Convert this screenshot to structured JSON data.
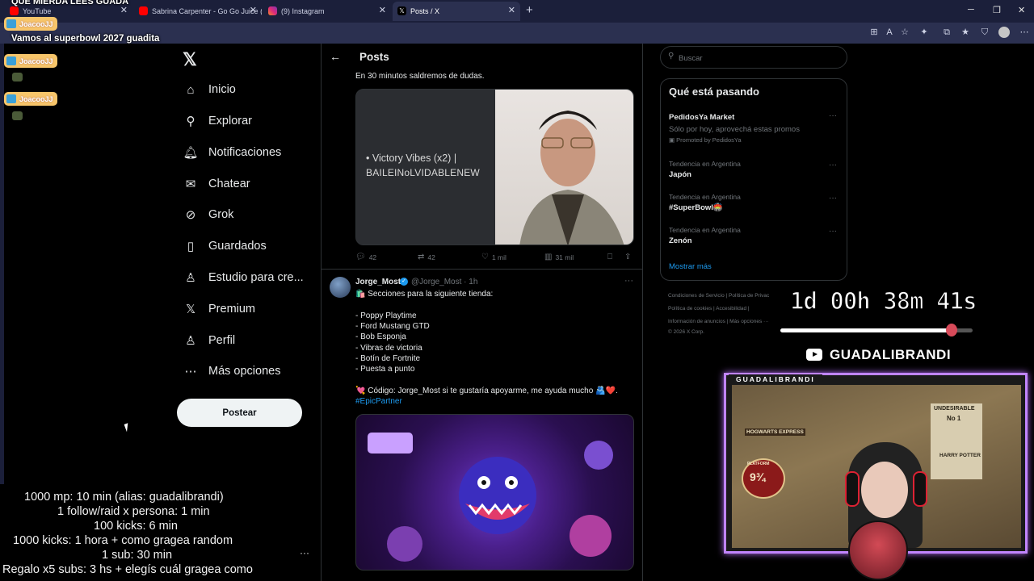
{
  "browser": {
    "tabs": [
      {
        "label": "YouTube",
        "active": false
      },
      {
        "label": "Sabrina Carpenter - Go Go Juice (O",
        "active": false
      },
      {
        "label": "(9) Instagram",
        "active": false
      },
      {
        "label": "Posts / X",
        "active": true
      }
    ],
    "new_tab": "+",
    "window_controls": [
      "─",
      "❐",
      "✕"
    ]
  },
  "sidebar": {
    "logo": "𝕏",
    "items": [
      {
        "label": "Inicio",
        "icon": "home-icon",
        "glyph": "⌂"
      },
      {
        "label": "Explorar",
        "icon": "search-icon",
        "glyph": "⚲"
      },
      {
        "label": "Notificaciones",
        "icon": "bell-icon",
        "glyph": "🔔︎"
      },
      {
        "label": "Chatear",
        "icon": "mail-icon",
        "glyph": "✉"
      },
      {
        "label": "Grok",
        "icon": "grok-icon",
        "glyph": "⊘"
      },
      {
        "label": "Guardados",
        "icon": "bookmark-icon",
        "glyph": "▯"
      },
      {
        "label": "Estudio para cre...",
        "icon": "flask-icon",
        "glyph": "♙"
      },
      {
        "label": "Premium",
        "icon": "x-premium-icon",
        "glyph": "𝕏"
      },
      {
        "label": "Perfil",
        "icon": "person-icon",
        "glyph": "♙"
      },
      {
        "label": "Más opciones",
        "icon": "more-circle-icon",
        "glyph": "⋯"
      }
    ],
    "post_button": "Postear"
  },
  "main": {
    "header_title": "Posts",
    "tweet1": {
      "text": "En 30 minutos saldremos de dudas.",
      "media_line1": "• Victory Vibes (x2) |",
      "media_line2": "BAILEINoLVIDABLENEW",
      "replies": "42",
      "reposts": "42",
      "likes": "1 mil",
      "views": "31 mil"
    },
    "tweet2": {
      "name": "Jorge_Most",
      "handle": "@Jorge_Most · 1h",
      "lines": [
        "🛍️ Secciones para la siguiente tienda:",
        "",
        "- Poppy Playtime",
        "- Ford Mustang GTD",
        "- Bob Esponja",
        "- Vibras de victoria",
        "- Botín de Fortnite",
        "- Puesta a punto",
        "",
        "💘 Código: Jorge_Most si te gustaría apoyarme, me ayuda mucho 🫂❤️."
      ],
      "hashtag": "#EpicPartner"
    }
  },
  "right": {
    "search_placeholder": "Buscar",
    "trends_title": "Qué está pasando",
    "trends": [
      {
        "top": "PedidosYa Market",
        "middle": "Sólo por hoy, aprovechá estas promos",
        "bottom": "Promoted by PedidosYa"
      },
      {
        "top": "Tendencia en Argentina",
        "middle": "Japón"
      },
      {
        "top": "Tendencia en Argentina",
        "middle": "#SuperBowl🏟️"
      },
      {
        "top": "Tendencia en Argentina",
        "middle": "Zenón"
      }
    ],
    "show_more": "Mostrar más",
    "footer": [
      "Condiciones de Servicio  |  Política de Privac",
      "Política de cookies  |  Accesibilidad  |",
      "Información de anuncios  |  Más opciones ···",
      "© 2026 X Corp."
    ]
  },
  "overlay": {
    "top_line1": "QUE MIERDA LEES GUADA",
    "top_line2": "Vamos al superbowl 2027 guadita",
    "chat_user": "JoacooJJ",
    "rules": [
      "1000 mp: 10 min (alias: guadalibrandi)",
      "1 follow/raid x persona: 1 min",
      "100 kicks: 6 min",
      "1000 kicks: 1 hora + como gragea random",
      "1 sub: 30 min",
      "Regalo x5 subs: 3 hs + elegís cuál gragea como"
    ],
    "timer": "1d 00h 38m 41s",
    "timer_progress": 0.88,
    "channel": "GUADALIBRANDI",
    "cam_label": "GUADALIBRANDI",
    "poster_title": "UNDESIRABLE",
    "poster_no": "No 1",
    "poster_name": "HARRY POTTER",
    "platform_label": "PLATFORM",
    "platform_number": "9¾",
    "sign": "HOGWARTS EXPRESS"
  },
  "colors": {
    "accent": "#1d9bf0",
    "browser_bar": "#2b3050",
    "cam_border": "#c084fc",
    "chip": "#f7c56a"
  }
}
